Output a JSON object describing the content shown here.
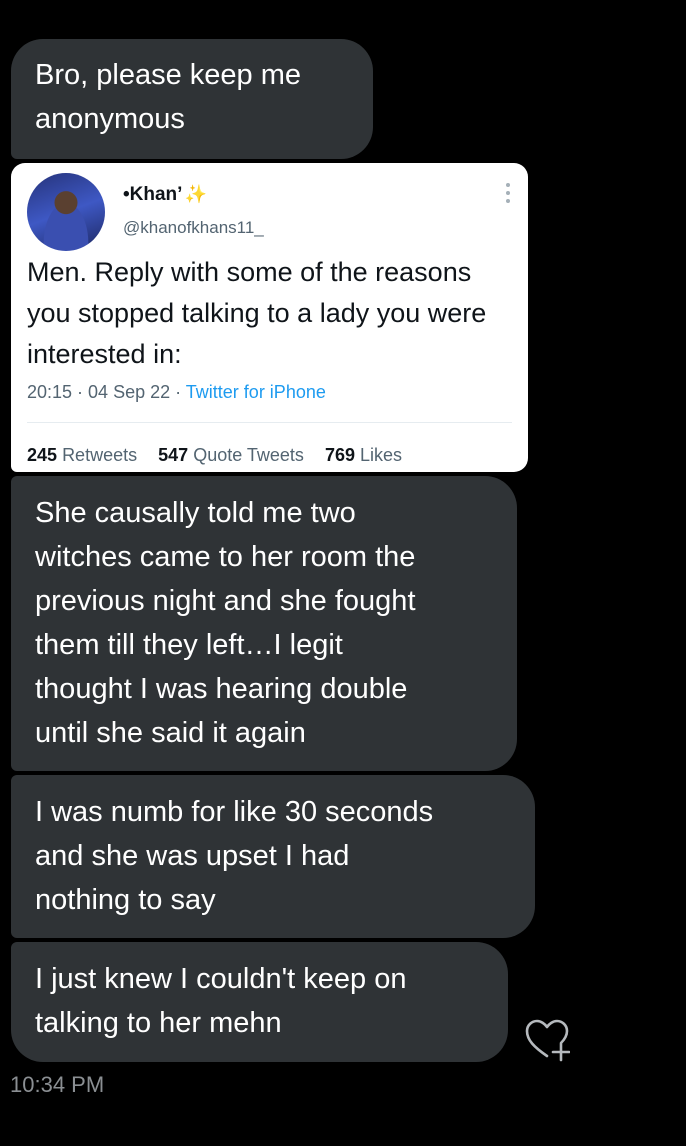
{
  "messages": [
    {
      "text": "Bro, please keep me\nanonymous"
    },
    {
      "text": "She causally told me two\nwitches came to her room the\nprevious night and she fought\nthem till they left…I legit\nthought I was hearing double\nuntil she said it again"
    },
    {
      "text": "I was numb for like 30 seconds\nand she was upset I had\nnothing to say"
    },
    {
      "text": "I just knew I couldn't keep on\ntalking to her mehn"
    }
  ],
  "tweet": {
    "author_name": "•Khan’",
    "author_name_icon": "sparkle-icon",
    "author_handle": "@khanofkhans11_",
    "text": "Men. Reply with some of the reasons you stopped talking to a lady you were interested in:",
    "time": "20:15 · 04 Sep 22 · ",
    "source": "Twitter for iPhone",
    "stats": {
      "retweets_count": "245",
      "retweets_label": "Retweets",
      "quotes_count": "547",
      "quotes_label": "Quote Tweets",
      "likes_count": "769",
      "likes_label": "Likes"
    },
    "menu_icon": "more-vertical-icon"
  },
  "reaction_icon": "heart-plus-icon",
  "timestamp": "10:34 PM",
  "colors": {
    "background": "#000000",
    "bubble": "#2f3336",
    "link": "#1d9bf0",
    "timestamp": "#8b8f93"
  }
}
